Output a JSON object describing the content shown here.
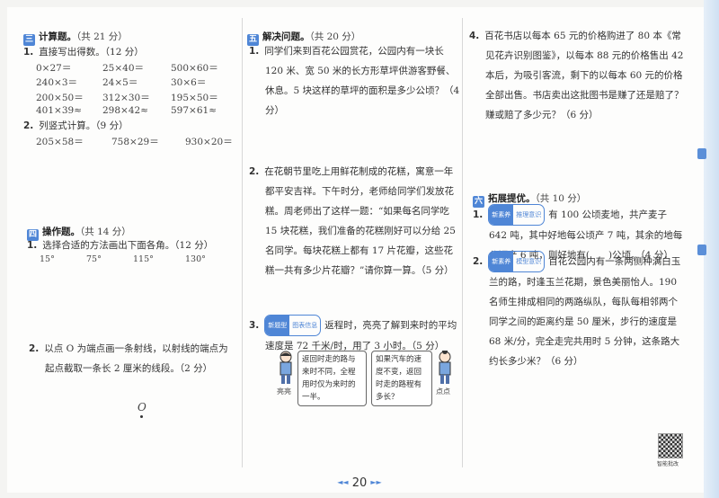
{
  "section3": {
    "icon": "三",
    "title": "计算题。",
    "points": "（共 21 分）",
    "q1": {
      "num": "1.",
      "text": "直接写出得数。（12 分）",
      "items": [
        "0×27＝",
        "25×40＝",
        "500×60＝",
        "240×3＝",
        "24×5＝",
        "30×6＝",
        "200×50＝",
        "312×30＝",
        "195×50＝",
        "401×39≈",
        "298×42≈",
        "597×61≈"
      ]
    },
    "q2": {
      "num": "2.",
      "text": "列竖式计算。（9 分）",
      "items": [
        "205×58＝",
        "758×29＝",
        "930×20＝"
      ]
    }
  },
  "section4": {
    "icon": "四",
    "title": "操作题。",
    "points": "（共 14 分）",
    "q1": {
      "num": "1.",
      "text": "选择合适的方法画出下面各角。（12 分）",
      "angles": [
        "15°",
        "75°",
        "115°",
        "130°"
      ]
    },
    "q2": {
      "num": "2.",
      "text": "以点 O 为端点画一条射线，以射线的端点为起点截取一条长 2 厘米的线段。（2 分）",
      "point_label": "O"
    }
  },
  "section5": {
    "icon": "五",
    "title": "解决问题。",
    "points": "（共 20 分）",
    "q1": {
      "num": "1.",
      "text": "同学们来到百花公园赏花，公园内有一块长 120 米、宽 50 米的长方形草坪供游客野餐、休息。5 块这样的草坪的面积是多少公顷？（4 分）"
    },
    "q2": {
      "num": "2.",
      "text": "在花朝节里吃上用鲜花制成的花糕，寓意一年都平安吉祥。下午时分，老师给同学们发放花糕。周老师出了这样一题：“如果每名同学吃 15 块花糕，我们准备的花糕刚好可以分给 25 名同学。每块花糕上都有 17 片花瓣，这些花糕一共有多少片花瓣？”请你算一算。（5 分）"
    },
    "q3": {
      "num": "3.",
      "badge_a": "新题型",
      "badge_b": "图表信息",
      "text": "返程时，亮亮了解到来时的平均速度是 72 千米/时，用了 3 小时。（5 分）",
      "bubble_left": "返回时走的路与来时不同，全程用时仅为来时的一半。",
      "bubble_right": "如果汽车的速度不变，返回时走的路程有多长？",
      "name_left": "亮亮",
      "name_right": "点点"
    },
    "q4": {
      "num": "4.",
      "text": "百花书店以每本 65 元的价格购进了 80 本《常见花卉识别图鉴》，以每本 88 元的价格售出 42 本后，为吸引客流，剩下的以每本 60 元的价格全部出售。书店卖出这批图书是赚了还是赔了？赚或赔了多少元？（6 分）"
    }
  },
  "section6": {
    "icon": "六",
    "title": "拓展提优。",
    "points": "（共 10 分）",
    "q1": {
      "num": "1.",
      "badge_a": "新素养",
      "badge_b": "推理意识",
      "text": "有 100 公顷麦地，共产麦子 642 吨，其中好地每公顷产 7 吨，其余的地每公顷产 6 吨，则好地有(　　)公顷。（4 分）"
    },
    "q2": {
      "num": "2.",
      "badge_a": "新素养",
      "badge_b": "模型意识",
      "text": "百花公园内有一条两侧种满白玉兰的路，时逢玉兰花期，景色美丽怡人。190 名师生排成相同的两路纵队，每队每相邻两个同学之间的距离约是 50 厘米，步行的速度是 68 米/分，完全走完共用时 5 分钟，这条路大约长多少米？（6 分）"
    }
  },
  "qr_label": "智能批改",
  "page_number": "20",
  "nav": {
    "prev": "◄◄",
    "next": "►►"
  },
  "colors": {
    "accent": "#4f86d6"
  }
}
